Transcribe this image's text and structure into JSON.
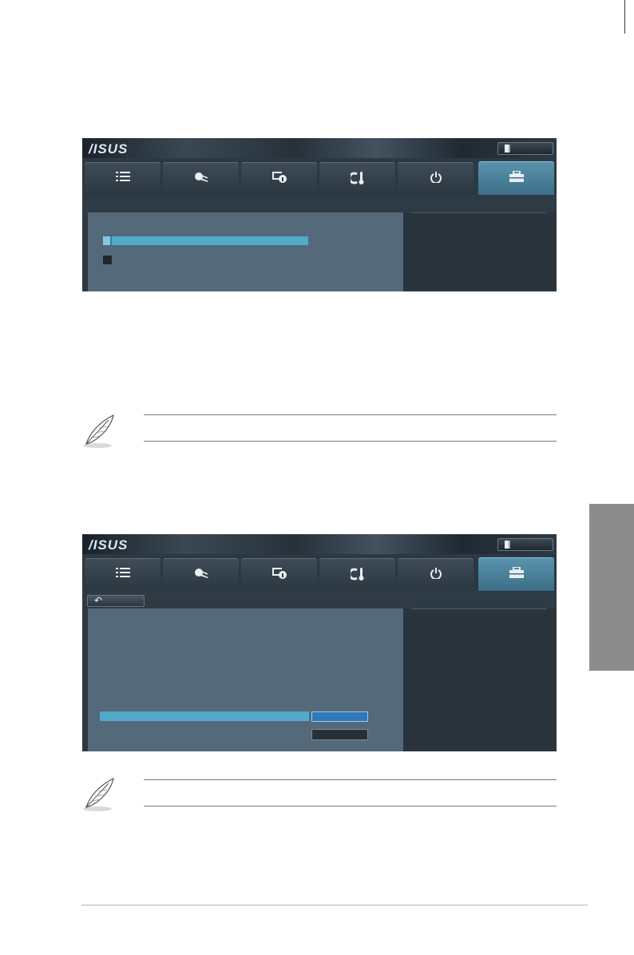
{
  "screens": [
    {
      "id": "tool-menu-screen",
      "logo_text": "/ISUS",
      "active_tab": 5,
      "show_back_button": false
    },
    {
      "id": "secure-erase-screen",
      "logo_text": "/ISUS",
      "active_tab": 5,
      "show_back_button": true
    }
  ],
  "tabs": [
    {
      "icon": "list-icon"
    },
    {
      "icon": "ai-tweaker-icon"
    },
    {
      "icon": "monitor-info-icon"
    },
    {
      "icon": "temperature-fan-icon"
    },
    {
      "icon": "power-icon"
    },
    {
      "icon": "toolbox-icon"
    }
  ],
  "back_glyph": "↶",
  "colors": {
    "highlight": "#52aac9",
    "panel": "#54697a",
    "value_button": "#2f78b9",
    "side_tab": "#8c8c8c"
  }
}
